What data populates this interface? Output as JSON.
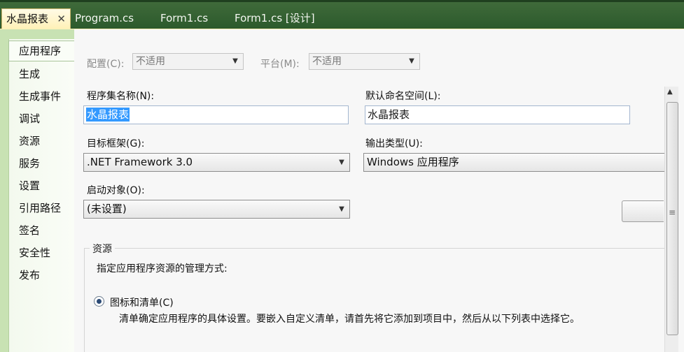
{
  "tabs": [
    {
      "label": "水晶报表",
      "active": true
    },
    {
      "label": "Program.cs",
      "active": false
    },
    {
      "label": "Form1.cs",
      "active": false
    },
    {
      "label": "Form1.cs [设计]",
      "active": false
    }
  ],
  "close_glyph": "✕",
  "nav": [
    "应用程序",
    "生成",
    "生成事件",
    "调试",
    "资源",
    "服务",
    "设置",
    "引用路径",
    "签名",
    "安全性",
    "发布"
  ],
  "config": {
    "config_label": "配置(C):",
    "config_value": "不适用",
    "platform_label": "平台(M):",
    "platform_value": "不适用"
  },
  "assembly": {
    "label": "程序集名称(N):",
    "value": "水晶报表"
  },
  "namespace": {
    "label": "默认命名空间(L):",
    "value": "水晶报表"
  },
  "framework": {
    "label": "目标框架(G):",
    "value": ".NET Framework 3.0"
  },
  "output": {
    "label": "输出类型(U):",
    "value": "Windows 应用程序"
  },
  "startup": {
    "label": "启动对象(O):",
    "value": "(未设置)"
  },
  "resources": {
    "title": "资源",
    "desc": "指定应用程序资源的管理方式:",
    "radio_label": "图标和清单(C)",
    "radio_desc": "清单确定应用程序的具体设置。要嵌入自定义清单，请首先将它添加到项目中，然后从以下列表中选择它。"
  },
  "colors": {
    "tabstrip": "#2c5a2c",
    "active_tab": "#fff1b8",
    "nav_bg": "#c8e2b3",
    "selection": "#3399ff"
  }
}
